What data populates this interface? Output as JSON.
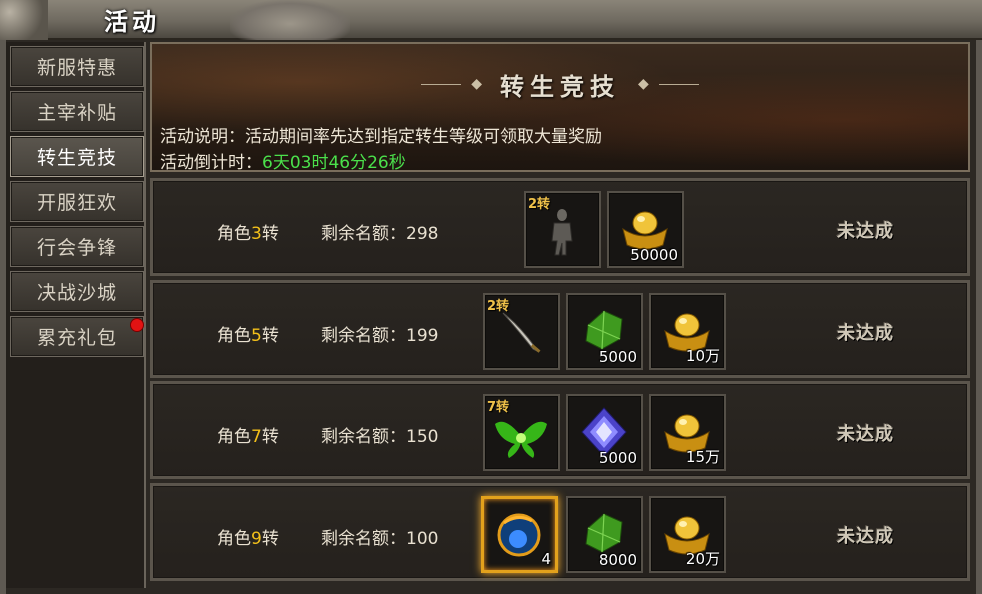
{
  "window": {
    "title": "活动"
  },
  "sidebar": {
    "items": [
      {
        "label": "新服特惠",
        "active": false,
        "badge": false
      },
      {
        "label": "主宰补贴",
        "active": false,
        "badge": false
      },
      {
        "label": "转生竞技",
        "active": true,
        "badge": false
      },
      {
        "label": "开服狂欢",
        "active": false,
        "badge": false
      },
      {
        "label": "行会争锋",
        "active": false,
        "badge": false
      },
      {
        "label": "决战沙城",
        "active": false,
        "badge": false
      },
      {
        "label": "累充礼包",
        "active": false,
        "badge": true
      }
    ]
  },
  "banner": {
    "heading": "转生竞技",
    "description": "活动说明：活动期间率先达到指定转生等级可领取大量奖励",
    "countdown_label": "活动倒计时：",
    "countdown_value": "6天03时46分26秒",
    "countdown_color": "#4be04b"
  },
  "rows": [
    {
      "role_prefix": "角色",
      "role_num": "3",
      "role_suffix": "转",
      "quota": "剩余名额：298",
      "status": "未达成",
      "rewards": [
        {
          "icon": "armor-icon",
          "tag": "2转",
          "count": ""
        },
        {
          "icon": "gold-ingot-icon",
          "tag": "",
          "count": "50000"
        }
      ]
    },
    {
      "role_prefix": "角色",
      "role_num": "5",
      "role_suffix": "转",
      "quota": "剩余名额：199",
      "status": "未达成",
      "rewards": [
        {
          "icon": "sword-icon",
          "tag": "2转",
          "count": ""
        },
        {
          "icon": "green-gem-icon",
          "tag": "",
          "count": "5000"
        },
        {
          "icon": "gold-ingot-icon",
          "tag": "",
          "count": "10万"
        }
      ]
    },
    {
      "role_prefix": "角色",
      "role_num": "7",
      "role_suffix": "转",
      "quota": "剩余名额：150",
      "status": "未达成",
      "rewards": [
        {
          "icon": "green-wings-icon",
          "tag": "7转",
          "count": ""
        },
        {
          "icon": "purple-crystal-icon",
          "tag": "",
          "count": "5000"
        },
        {
          "icon": "gold-ingot-icon",
          "tag": "",
          "count": "15万"
        }
      ]
    },
    {
      "role_prefix": "角色",
      "role_num": "9",
      "role_suffix": "转",
      "quota": "剩余名额：100",
      "status": "未达成",
      "rewards": [
        {
          "icon": "blue-amulet-icon",
          "tag": "",
          "count": "4"
        },
        {
          "icon": "green-gem-icon",
          "tag": "",
          "count": "8000"
        },
        {
          "icon": "gold-ingot-icon",
          "tag": "",
          "count": "20万"
        }
      ]
    }
  ],
  "colors": {
    "role_number": "#f3c01a",
    "notify_badge": "#e21313"
  }
}
